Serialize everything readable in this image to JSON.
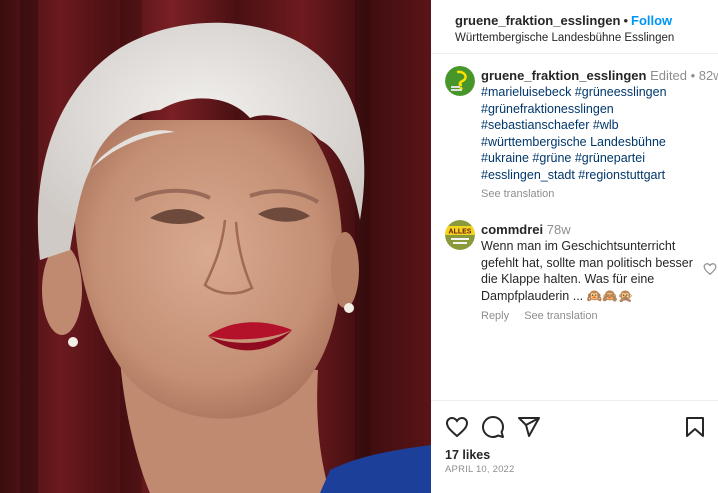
{
  "post": {
    "image_alt": "Portrait photo of a woman with short white hair and red lipstick against a dark red curtain"
  },
  "header": {
    "username": "gruene_fraktion_esslingen",
    "separator": "•",
    "follow_label": "Follow",
    "location": "Württembergische Landesbühne Esslingen"
  },
  "caption": {
    "username": "gruene_fraktion_esslingen",
    "edited": "Edited",
    "separator": "•",
    "age": "82w",
    "tags": [
      "#marieluisebeck #grüneesslingen",
      "#grünefraktionesslingen",
      "#sebastianschaefer #wlb",
      "#württembergische Landesbühne",
      "#ukraine #grüne #grünepartei",
      "#esslingen_stadt #regionstuttgart"
    ],
    "see_translation": "See translation"
  },
  "comment": {
    "username": "commdrei",
    "age": "78w",
    "text": "Wenn man im Geschichtsunterricht gefehlt hat, sollte man politisch besser die Klappe halten. Was für eine Dampfplauderin ... 🙉🙈🙊",
    "reply_label": "Reply",
    "see_translation": "See translation",
    "avatar_text": "ALLES"
  },
  "actions": {
    "like_icon": "heart-icon",
    "comment_icon": "comment-icon",
    "share_icon": "share-icon",
    "save_icon": "bookmark-icon"
  },
  "stats": {
    "likes": "17 likes",
    "date": "APRIL 10, 2022"
  },
  "colors": {
    "follow": "#0095f6",
    "hashtag": "#00376b",
    "muted": "#8e8e8e",
    "curtain": "#5a1417",
    "party_green": "#46962b"
  }
}
